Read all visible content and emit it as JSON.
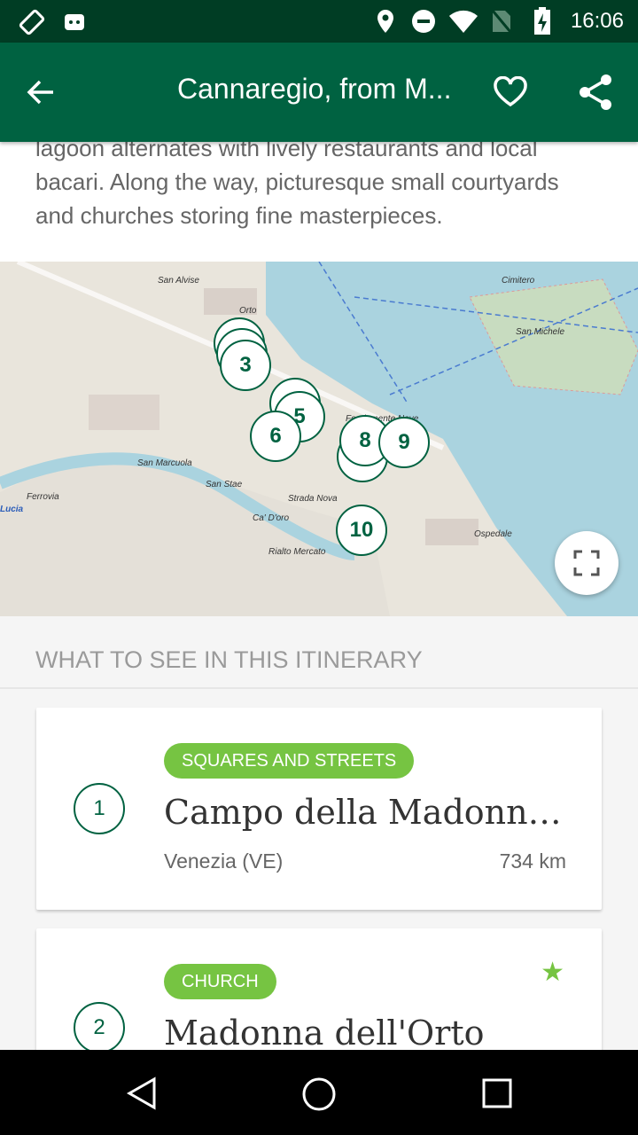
{
  "status_bar": {
    "time": "16:06",
    "icons": [
      "screen-rotate-icon",
      "android-icon",
      "location-icon",
      "dnd-icon",
      "wifi-icon",
      "no-sim-icon",
      "battery-charging-icon"
    ]
  },
  "app_bar": {
    "title": "Cannaregio, from Madonna dell'Orto",
    "title_display": "Cannaregio, from M...",
    "icons": [
      "back-arrow-icon",
      "heart-icon",
      "share-icon"
    ]
  },
  "description": {
    "lines": [
      "lagoon alternates with lively restaurants and local",
      "bacari. Along the way, picturesque small courtyards",
      "and churches storing fine masterpieces."
    ]
  },
  "map": {
    "labels": [
      "San Alvise",
      "Orto",
      "Cimitero",
      "San Michele",
      "San Marcuola",
      "San Stae",
      "Ca' D'oro",
      "Rialto Mercato",
      "Ospedale",
      "Ferrovia",
      "Lucia",
      "Fondamente Nove",
      "Strada Nova"
    ],
    "markers": [
      "1",
      "2",
      "3",
      "4",
      "5",
      "6",
      "7",
      "8",
      "9",
      "10"
    ]
  },
  "section_title": "WHAT TO SEE IN THIS ITINERARY",
  "items": [
    {
      "number": "1",
      "category": "SQUARES AND STREETS",
      "name": "Campo della Madonna dell'Orto",
      "location": "Venezia (VE)",
      "distance": "734 km",
      "starred": false
    },
    {
      "number": "2",
      "category": "CHURCH",
      "name": "Madonna dell'Orto",
      "starred": true
    }
  ],
  "colors": {
    "primary": "#006241",
    "status": "#003d24",
    "accent": "#76c442"
  }
}
